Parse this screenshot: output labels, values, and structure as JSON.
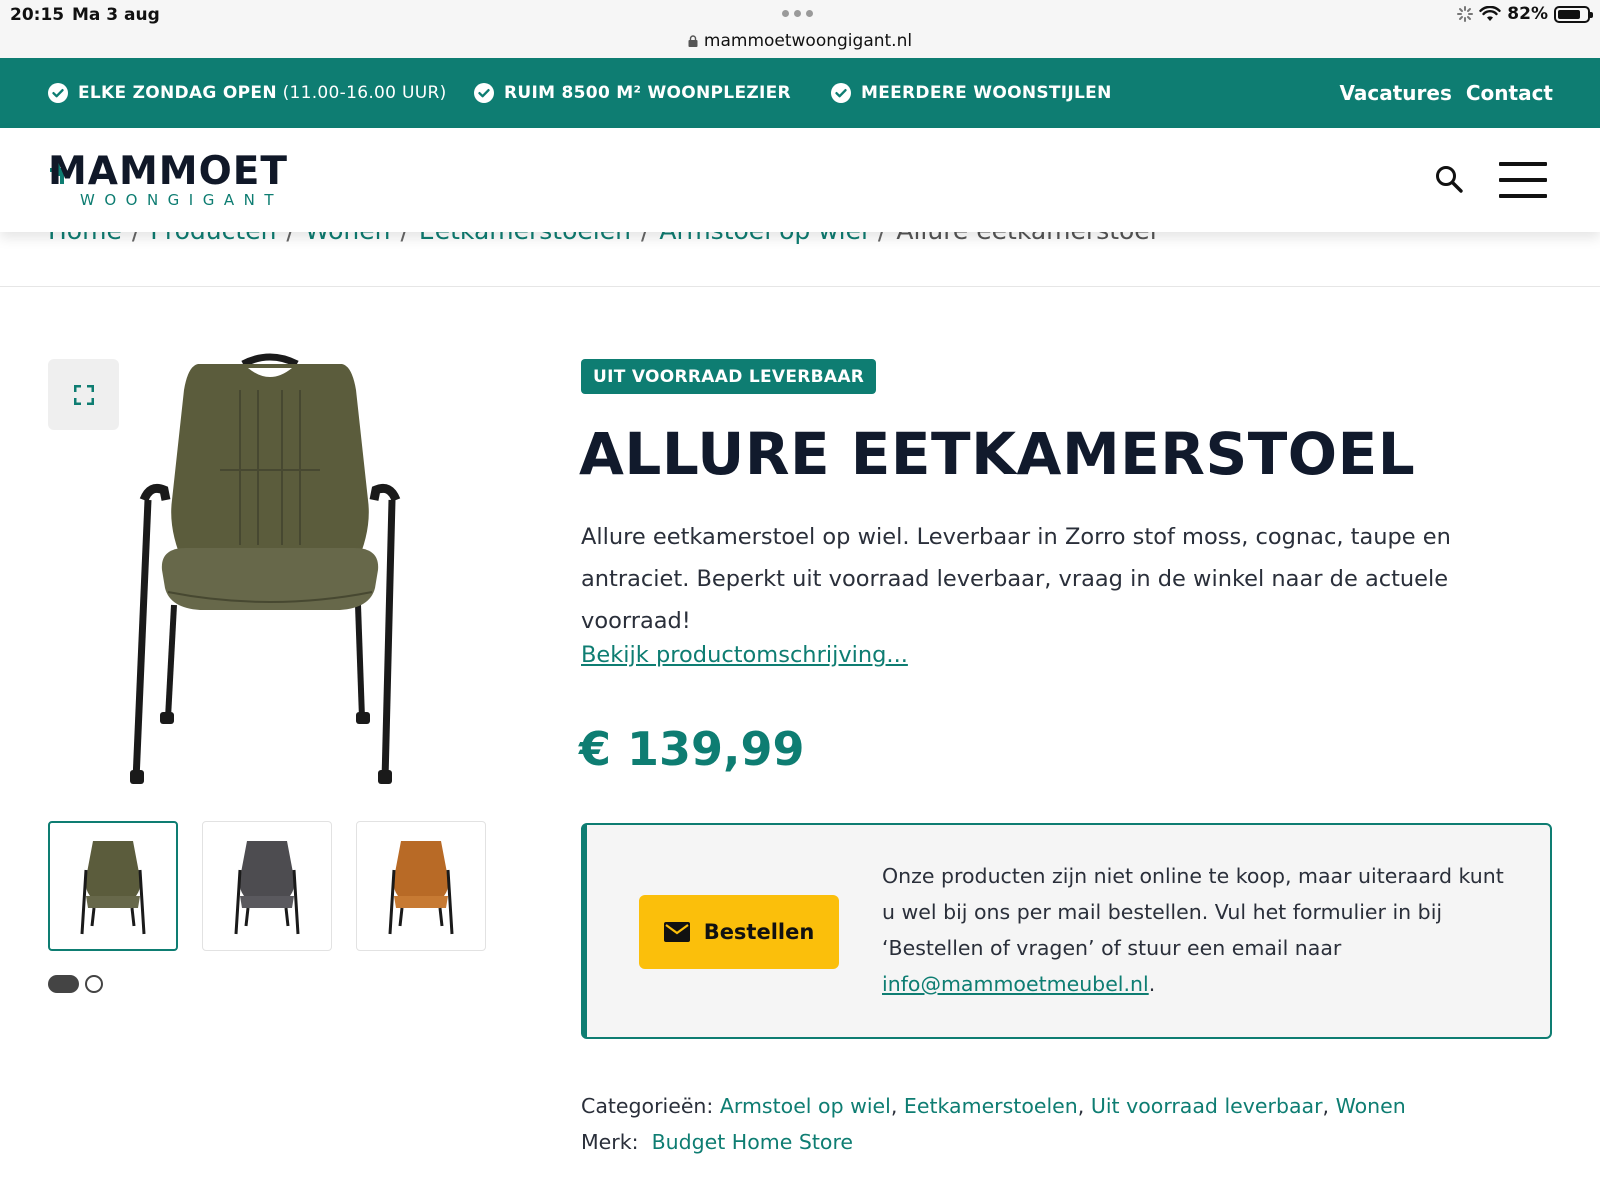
{
  "statusbar": {
    "time": "20:15",
    "date": "Ma 3 aug",
    "battery": "82%",
    "url": "mammoetwoongigant.nl"
  },
  "topbar": {
    "usps": [
      {
        "bold": "ELKE ZONDAG OPEN",
        "light": " (11.00-16.00 UUR)"
      },
      {
        "bold": "RUIM 8500 M² WOONPLEZIER",
        "light": ""
      },
      {
        "bold": "MEERDERE WOONSTIJLEN",
        "light": ""
      }
    ],
    "nav": [
      "Vacatures",
      "Contact"
    ],
    "bg_color": "#0e7d72"
  },
  "header": {
    "logo_main": "MAMMOET",
    "logo_sub": "WOONGIGANT"
  },
  "breadcrumb": {
    "items": [
      "Home",
      "Producten",
      "Wonen",
      "Eetkamerstoelen",
      "Armstoel op wiel"
    ],
    "separator": "/",
    "current": "Allure eetkamerstoel"
  },
  "gallery": {
    "thumbnails": [
      {
        "name": "chair-moss",
        "color": "#5b5c3c",
        "active": true
      },
      {
        "name": "chair-antraciet",
        "color": "#4d4c50",
        "active": false
      },
      {
        "name": "chair-cognac",
        "color": "#b86a26",
        "active": false
      }
    ],
    "page_dots": 2,
    "active_dot": 0
  },
  "product": {
    "badge": "UIT VOORRAAD LEVERBAAR",
    "title": "ALLURE EETKAMERSTOEL",
    "description": "Allure eetkamerstoel op wiel. Leverbaar in Zorro stof moss, cognac, taupe en antraciet. Beperkt uit voorraad leverbaar, vraag in de winkel naar de actuele voorraad!",
    "more_link": "Bekijk productomschrijving...",
    "price": "€ 139,99"
  },
  "order": {
    "button_label": "Bestellen",
    "text": "Onze producten zijn niet online te koop, maar uiteraard kunt u wel bij ons per mail bestellen. Vul het formulier in bij ‘Bestellen of vragen’ of stuur een email naar ",
    "email": "info@mammoetmeubel.nl",
    "text_end": ".",
    "button_color": "#fbbf0b"
  },
  "meta": {
    "categories_label": "Categorieën:",
    "categories": [
      "Armstoel op wiel",
      "Eetkamerstoelen",
      "Uit voorraad leverbaar",
      "Wonen"
    ],
    "brand_label": "Merk:",
    "brand": "Budget Home Store"
  }
}
